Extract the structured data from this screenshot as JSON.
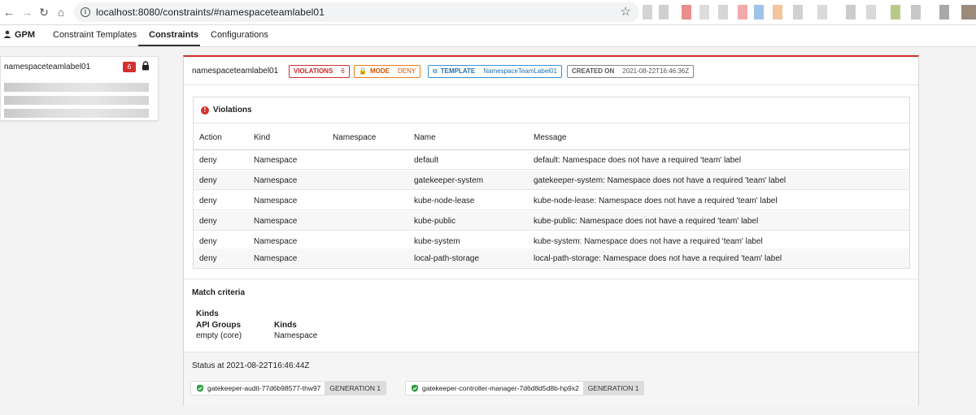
{
  "browser": {
    "url": "localhost:8080/constraints/#namespaceteamlabel01"
  },
  "nav": {
    "brand": "GPM",
    "links": [
      "Constraint Templates",
      "Constraints",
      "Configurations"
    ],
    "active": "Constraints"
  },
  "sidebar": {
    "items": [
      {
        "label": "namespaceteamlabel01",
        "badge": "6",
        "locked": true
      }
    ]
  },
  "constraint": {
    "name": "namespaceteamlabel01",
    "violations_label": "VIOLATIONS",
    "violations_count": "6",
    "mode_label": "MODE",
    "mode_value": "DENY",
    "template_label": "TEMPLATE",
    "template_value": "NamespaceTeamLabel01",
    "created_label": "CREATED ON",
    "created_value": "2021-08-22T16:46:36Z"
  },
  "violations": {
    "title": "Violations",
    "columns": [
      "Action",
      "Kind",
      "Namespace",
      "Name",
      "Message"
    ],
    "rows": [
      {
        "action": "deny",
        "kind": "Namespace",
        "namespace": "",
        "name": "default",
        "message": "default: Namespace does not have a required 'team' label"
      },
      {
        "action": "deny",
        "kind": "Namespace",
        "namespace": "",
        "name": "gatekeeper-system",
        "message": "gatekeeper-system: Namespace does not have a required 'team' label"
      },
      {
        "action": "deny",
        "kind": "Namespace",
        "namespace": "",
        "name": "kube-node-lease",
        "message": "kube-node-lease: Namespace does not have a required 'team' label"
      },
      {
        "action": "deny",
        "kind": "Namespace",
        "namespace": "",
        "name": "kube-public",
        "message": "kube-public: Namespace does not have a required 'team' label"
      },
      {
        "action": "deny",
        "kind": "Namespace",
        "namespace": "",
        "name": "kube-system",
        "message": "kube-system: Namespace does not have a required 'team' label"
      },
      {
        "action": "deny",
        "kind": "Namespace",
        "namespace": "",
        "name": "local-path-storage",
        "message": "local-path-storage: Namespace does not have a required 'team' label"
      }
    ]
  },
  "match": {
    "title": "Match criteria",
    "kinds_heading": "Kinds",
    "api_groups_label": "API Groups",
    "api_groups_value": "empty (core)",
    "kinds_label": "Kinds",
    "kinds_value": "Namespace"
  },
  "status": {
    "title": "Status at 2021-08-22T16:46:44Z",
    "pods": [
      {
        "name": "gatekeeper-audit-77d6b98577-thw97",
        "generation": "GENERATION 1"
      },
      {
        "name": "gatekeeper-controller-manager-7d6d8d5d8b-hp9x2",
        "generation": "GENERATION 1"
      }
    ]
  },
  "colors": {
    "danger": "#d32f2f",
    "warning": "#e67e22",
    "info": "#3a8fd1",
    "success": "#2e9e44"
  }
}
